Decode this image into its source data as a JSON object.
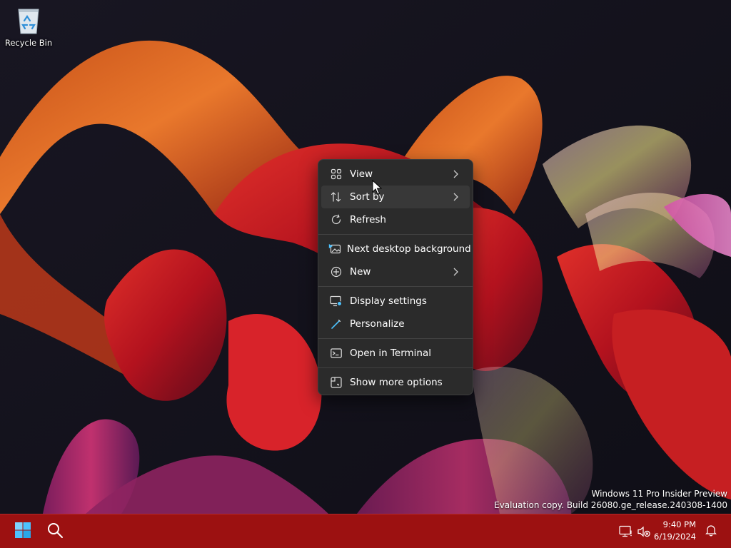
{
  "desktop": {
    "icons": [
      {
        "label": "Recycle Bin",
        "icon": "recycle-bin-icon"
      }
    ]
  },
  "context_menu": {
    "groups": [
      [
        {
          "label": "View",
          "icon": "view-grid-icon",
          "submenu": true
        },
        {
          "label": "Sort by",
          "icon": "sort-icon",
          "submenu": true
        },
        {
          "label": "Refresh",
          "icon": "refresh-icon",
          "submenu": false
        }
      ],
      [
        {
          "label": "Next desktop background",
          "icon": "next-background-icon",
          "submenu": false
        },
        {
          "label": "New",
          "icon": "new-plus-icon",
          "submenu": true
        }
      ],
      [
        {
          "label": "Display settings",
          "icon": "display-settings-icon",
          "submenu": false
        },
        {
          "label": "Personalize",
          "icon": "personalize-pen-icon",
          "submenu": false
        }
      ],
      [
        {
          "label": "Open in Terminal",
          "icon": "terminal-icon",
          "submenu": false
        }
      ],
      [
        {
          "label": "Show more options",
          "icon": "show-more-options-icon",
          "submenu": false
        }
      ]
    ],
    "hovered_item": "Sort by"
  },
  "watermark": {
    "line1": "Windows 11 Pro Insider Preview",
    "line2": "Evaluation copy. Build 26080.ge_release.240308-1400"
  },
  "taskbar": {
    "buttons": [
      {
        "name": "start-button",
        "icon": "windows-logo-icon"
      },
      {
        "name": "search-button",
        "icon": "search-icon"
      }
    ],
    "tray": {
      "icons": [
        "network-icon",
        "volume-muted-icon"
      ],
      "time": "9:40 PM",
      "date": "6/19/2024",
      "notification_icon": "bell-icon"
    }
  },
  "colors": {
    "taskbar": "#9c1111",
    "menu_background": "#2b2b2b",
    "menu_hover": "#383838",
    "accent_blue": "#4cc2ff"
  }
}
